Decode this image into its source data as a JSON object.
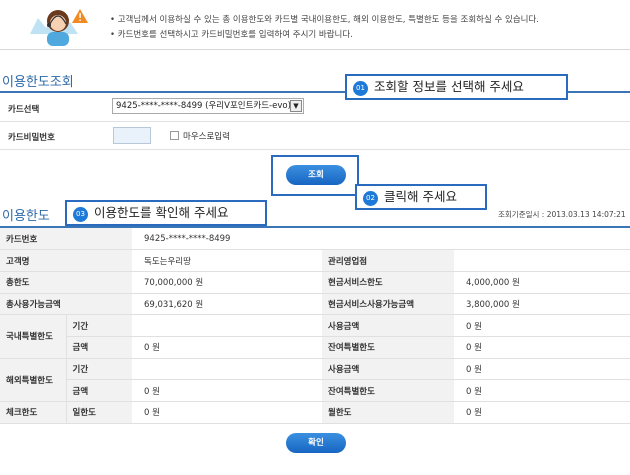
{
  "notice": {
    "line1": "• 고객님께서 이용하실 수 있는 총 이용한도와 카드별 국내이용한도, 해외 이용한도, 특별한도 등을 조회하실 수 있습니다.",
    "line2": "• 카드번호를 선택하시고 카드비밀번호를 입력하여 주시기 바랍니다."
  },
  "inquiry": {
    "title": "이용한도조회",
    "card_select_label": "카드선택",
    "card_select_value": "9425-****-****-8499 (우리V포인트카드-evo)",
    "password_label": "카드비밀번호",
    "mouse_input_label": "마우스로입력",
    "search_button": "조회"
  },
  "callouts": {
    "c1_num": "01",
    "c1_text": "조회할 정보를 선택해 주세요",
    "c2_num": "02",
    "c2_text": "클릭해 주세요",
    "c3_num": "03",
    "c3_text": "이용한도를 확인해 주세요"
  },
  "limits": {
    "title": "이용한도",
    "as_of": "조회기준일시 : 2013.03.13 14:07:21",
    "card_no_label": "카드번호",
    "card_no": "9425-****-****-8499",
    "customer_label": "고객명",
    "customer": "독도는우리땅",
    "branch_label": "관리영업점",
    "branch": "",
    "total_label": "총한도",
    "total": "70,000,000 원",
    "cash_label": "현금서비스한도",
    "cash": "4,000,000 원",
    "available_label": "총사용가능금액",
    "available": "69,031,620 원",
    "cash_available_label": "현금서비스사용가능금액",
    "cash_available": "3,800,000 원",
    "domestic_special_label": "국내특별한도",
    "overseas_special_label": "해외특별한도",
    "period_label": "기간",
    "amount_label": "금액",
    "used_label": "사용금액",
    "remaining_label": "잔여특별한도",
    "domestic_period": "",
    "domestic_amount": "0 원",
    "domestic_used": "0 원",
    "domestic_remaining": "0 원",
    "overseas_period": "",
    "overseas_amount": "0 원",
    "overseas_used": "0 원",
    "overseas_remaining": "0 원",
    "check_label": "체크한도",
    "daily_label": "일한도",
    "daily": "0 원",
    "monthly_label": "월한도",
    "monthly": "0 원",
    "confirm_button": "확인"
  },
  "colors": {
    "accent": "#2e6aa8",
    "button": "#1766c2",
    "callout_border": "#2a6bc0"
  }
}
